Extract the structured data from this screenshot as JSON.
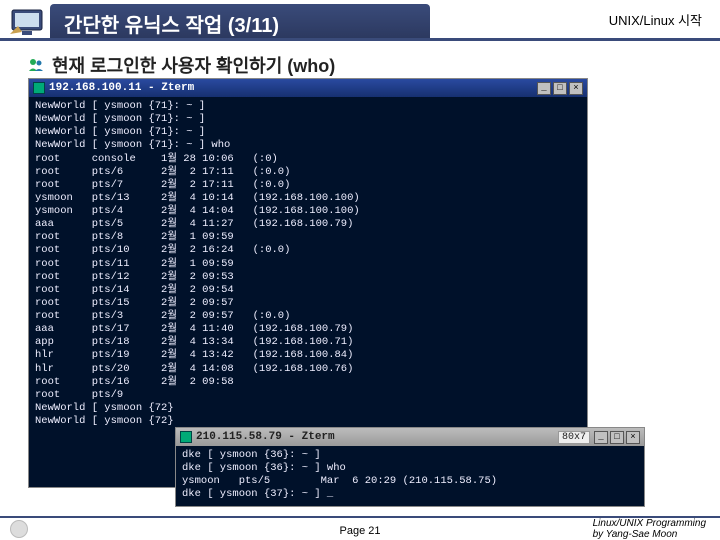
{
  "header": {
    "title": "간단한 유닉스 작업 (3/11)",
    "corner": "UNIX/Linux 시작"
  },
  "bullet": {
    "text": "현재 로그인한 사용자 확인하기 (who)"
  },
  "term1": {
    "title": "192.168.100.11 - Zterm",
    "body": "NewWorld [ ysmoon {71}: ~ ]\nNewWorld [ ysmoon {71}: ~ ]\nNewWorld [ ysmoon {71}: ~ ]\nNewWorld [ ysmoon {71}: ~ ] who\nroot     console    1월 28 10:06   (:0)\nroot     pts/6      2월  2 17:11   (:0.0)\nroot     pts/7      2월  2 17:11   (:0.0)\nysmoon   pts/13     2월  4 10:14   (192.168.100.100)\nysmoon   pts/4      2월  4 14:04   (192.168.100.100)\naaa      pts/5      2월  4 11:27   (192.168.100.79)\nroot     pts/8      2월  1 09:59\nroot     pts/10     2월  2 16:24   (:0.0)\nroot     pts/11     2월  1 09:59\nroot     pts/12     2월  2 09:53\nroot     pts/14     2월  2 09:54\nroot     pts/15     2월  2 09:57\nroot     pts/3      2월  2 09:57   (:0.0)\naaa      pts/17     2월  4 11:40   (192.168.100.79)\napp      pts/18     2월  4 13:34   (192.168.100.71)\nhlr      pts/19     2월  4 13:42   (192.168.100.84)\nhlr      pts/20     2월  4 14:08   (192.168.100.76)\nroot     pts/16     2월  2 09:58\nroot     pts/9\nNewWorld [ ysmoon {72}\nNewWorld [ ysmoon {72}"
  },
  "term2": {
    "title": "210.115.58.79 - Zterm",
    "size": "80x7",
    "body": "dke [ ysmoon {36}: ~ ]\ndke [ ysmoon {36}: ~ ] who\nysmoon   pts/5        Mar  6 20:29 (210.115.58.75)\ndke [ ysmoon {37}: ~ ] _"
  },
  "footer": {
    "page": "Page 21",
    "credit1": "Linux/UNIX Programming",
    "credit2": "by Yang-Sae Moon"
  }
}
